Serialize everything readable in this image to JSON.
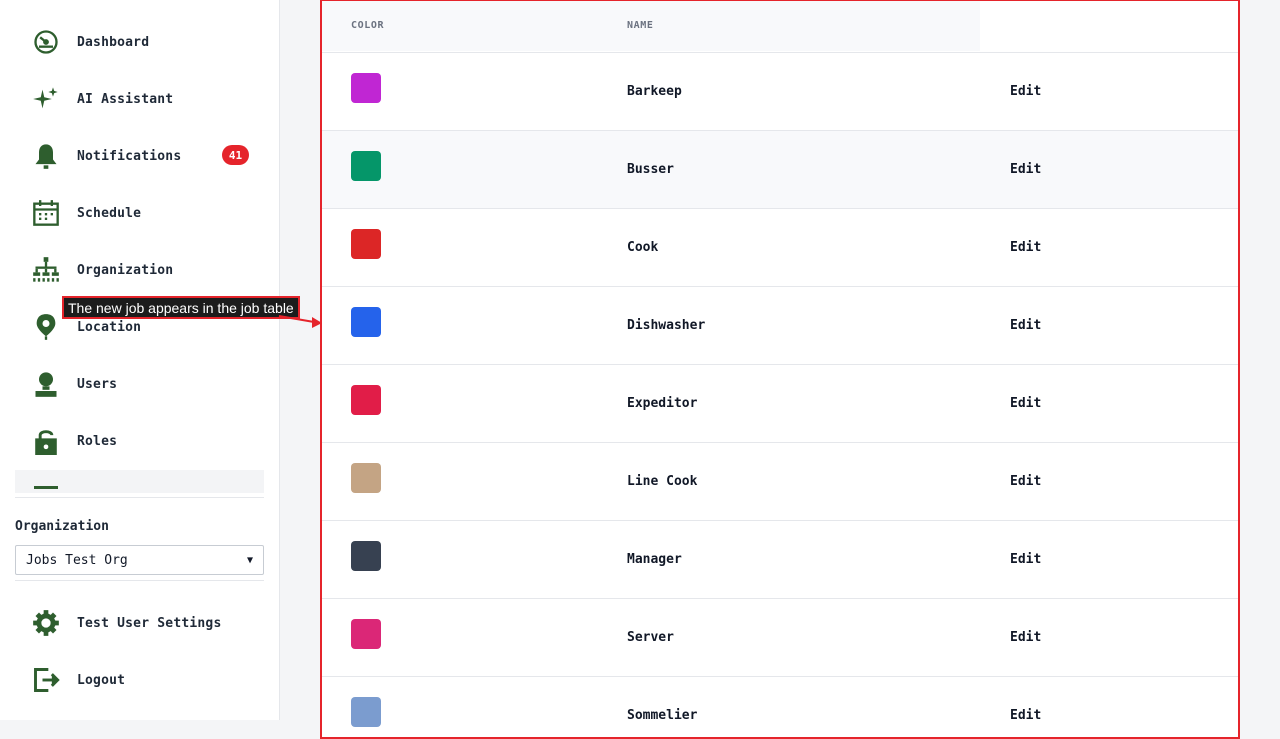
{
  "sidebar": {
    "items": [
      {
        "label": "Dashboard",
        "icon": "dashboard-icon"
      },
      {
        "label": "AI Assistant",
        "icon": "sparkle-icon"
      },
      {
        "label": "Notifications",
        "icon": "bell-icon",
        "badge": "41"
      },
      {
        "label": "Schedule",
        "icon": "calendar-icon"
      },
      {
        "label": "Organization",
        "icon": "org-chart-icon"
      },
      {
        "label": "Location",
        "icon": "location-pin-icon"
      },
      {
        "label": "Users",
        "icon": "user-icon"
      },
      {
        "label": "Roles",
        "icon": "unlock-icon"
      }
    ],
    "organization_label": "Organization",
    "organization_selected": "Jobs Test Org",
    "bottom_items": [
      {
        "label": "Test User Settings",
        "icon": "gear-icon"
      },
      {
        "label": "Logout",
        "icon": "logout-icon"
      }
    ]
  },
  "table": {
    "headers": {
      "color": "COLOR",
      "name": "NAME"
    },
    "edit_label": "Edit",
    "rows": [
      {
        "name": "Barkeep",
        "color": "#c026d3"
      },
      {
        "name": "Busser",
        "color": "#059669"
      },
      {
        "name": "Cook",
        "color": "#dc2626"
      },
      {
        "name": "Dishwasher",
        "color": "#2563eb"
      },
      {
        "name": "Expeditor",
        "color": "#e11d48"
      },
      {
        "name": "Line Cook",
        "color": "#c4a484"
      },
      {
        "name": "Manager",
        "color": "#374151"
      },
      {
        "name": "Server",
        "color": "#db2777"
      },
      {
        "name": "Sommelier",
        "color": "#7b9ccf"
      }
    ]
  },
  "annotation": {
    "text": "The new job appears in the job table"
  },
  "colors": {
    "icon_green": "#2e5e2e",
    "badge_red": "#e5242b",
    "highlight_red": "#e5242b"
  }
}
